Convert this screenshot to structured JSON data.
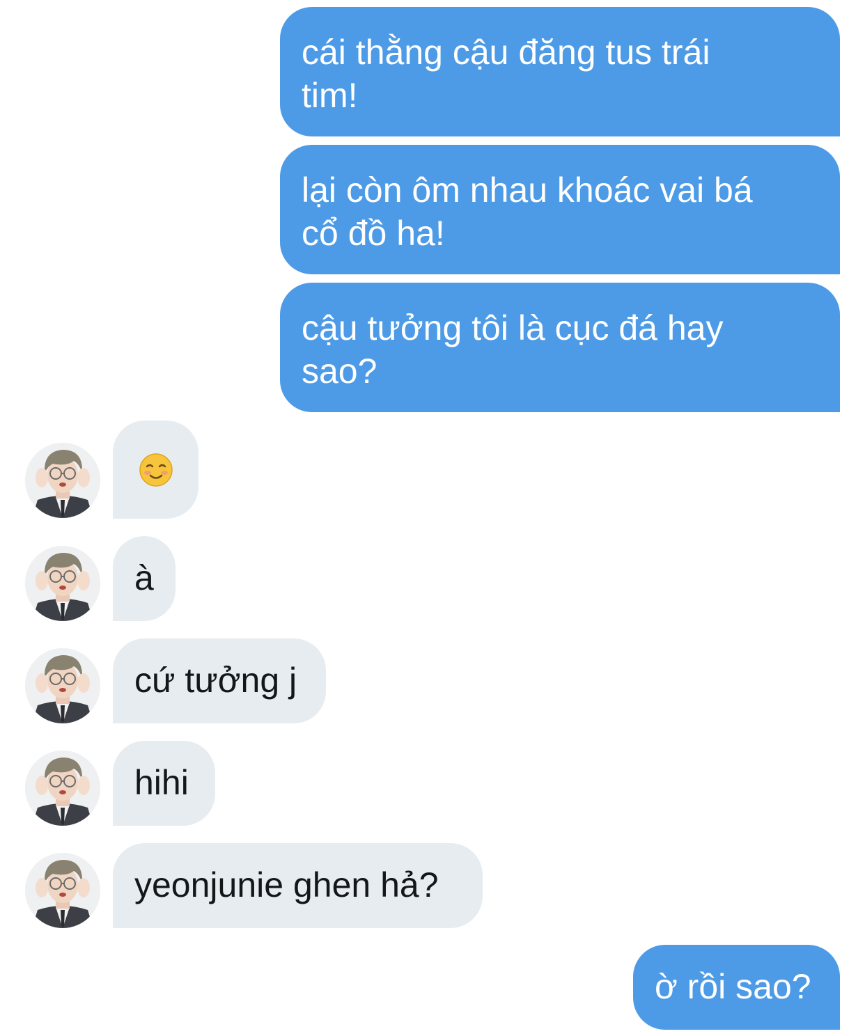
{
  "conversation": {
    "sent_messages": [
      {
        "line1": "cái thằng cậu đăng tus trái",
        "line2": "tim!"
      },
      {
        "line1": "lại còn ôm nhau khoác vai bá",
        "line2": "cổ đồ ha!"
      },
      {
        "line1": "cậu tưởng tôi là cục đá hay",
        "line2": "sao?"
      }
    ],
    "received_messages": [
      {
        "text": "☺️",
        "icon": "smiling-face-emoji"
      },
      {
        "text": "à"
      },
      {
        "text": "cứ tưởng j"
      },
      {
        "text": "hihi"
      },
      {
        "text": "yeonjunie ghen hả?"
      }
    ],
    "last_sent_message": {
      "text": "ờ rồi sao?"
    }
  },
  "colors": {
    "sent_bubble": "#4d9be6",
    "received_bubble": "#e6ecf0",
    "received_text": "#14171a"
  },
  "avatar": {
    "icon": "user-avatar-photo"
  }
}
